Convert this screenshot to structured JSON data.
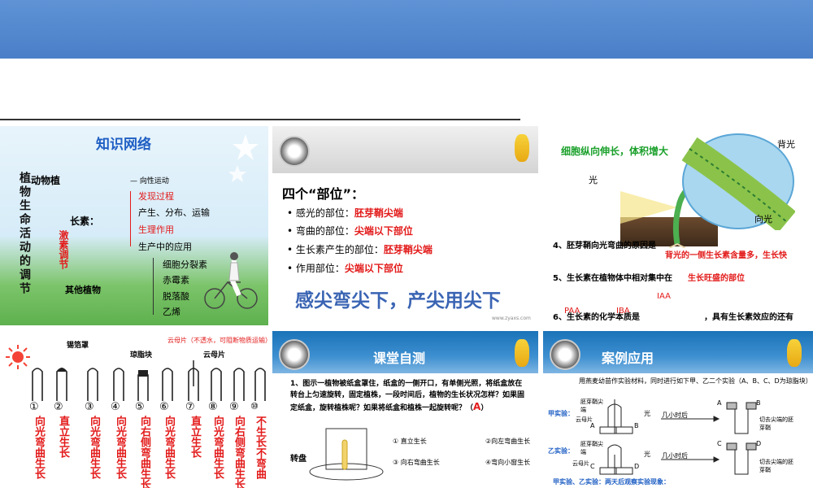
{
  "slide1": {
    "title": "知识网络",
    "vertical_title": "植物生命活动的调节",
    "top_branch": "动物植",
    "top_right": "— 向性运动",
    "growth": "长素：",
    "hormone": "激素调节",
    "items_red": [
      "发现过程",
      "生理作用"
    ],
    "items": [
      "产生、分布、运输",
      "生产中的应用"
    ],
    "other": "其他植物",
    "others": [
      "细胞分裂素",
      "赤霉素",
      "脱落酸",
      "乙烯"
    ]
  },
  "slide2": {
    "heading": "四个“部位”：",
    "rows": [
      {
        "label": "感光的部位：",
        "value": "胚芽鞘尖端"
      },
      {
        "label": "弯曲的部位：",
        "value": "尖端以下部位"
      },
      {
        "label": "生长素产生的部位：",
        "value": "胚芽鞘尖端"
      },
      {
        "label": "作用部位：",
        "value": "尖端以下部位"
      }
    ],
    "slogan": "感尖弯尖下，产尖用尖下",
    "footer": "www.zyaxs.com"
  },
  "slide3": {
    "caption_a": "细胞纵向伸长，",
    "caption_b": "体积增大",
    "label_back": "背光",
    "label_light": "光",
    "label_toward": "向光",
    "q4": "4、胚芽鞘向光弯曲的原因是",
    "a4": "背光的一侧生长素含量多，生长快",
    "q5": "5、生长素在植物体中相对集中在",
    "a5": "生长旺盛的部位",
    "a_iaa": "IAA",
    "q6": "6、生长素的化学本质是",
    "q6b": "，具有生长素效应的还有",
    "a_paa": "PAA",
    "a_iba": "IBA"
  },
  "slide4": {
    "labels_top": [
      "锡箔罩",
      "琼脂块",
      "云母片"
    ],
    "note": "云母片（不透水，可阻断物质运输）",
    "numbers": [
      "①",
      "②",
      "③",
      "④",
      "⑤",
      "⑥",
      "⑦",
      "⑧",
      "⑨",
      "⑩"
    ],
    "results": [
      "向光弯曲生长",
      "直立生长",
      "向光弯曲生长",
      "向光弯曲生长",
      "向右侧弯曲生长",
      "向光弯曲生长",
      "直立生长",
      "向光弯曲生长",
      "向右侧弯曲生长",
      "不生长不弯曲"
    ]
  },
  "slide5": {
    "title": "课堂自测",
    "question": "1、图示一植物被纸盒罩住，纸盒的一侧开口，有单侧光照，将纸盒放在转台上匀速旋转，固定植株，一段时间后，植物的生长状况怎样？如果固定纸盒，旋转植株呢？如果将纸盒和植株一起旋转呢？（",
    "answer": "A",
    "close": "）",
    "turntable": "转盘",
    "options": [
      "① 直立生长",
      "②向左弯曲生长",
      "③ 向右弯曲生长",
      "④弯向小窗生长"
    ]
  },
  "slide6": {
    "title": "案例应用",
    "intro": "用燕麦幼苗作实验材料，同时进行如下甲、乙二个实验（A、B、C、D为琼脂块）",
    "exp1": "甲实验：",
    "exp2": "乙实验：",
    "tip": "胚芽鞘尖端",
    "mica": "云母片",
    "light": "光",
    "hours": "几小时后",
    "cut": "切去尖端的胚芽鞘",
    "blocks": [
      "A",
      "B",
      "C",
      "D"
    ],
    "footer": "甲实验、乙实验：两天后观察实验现象："
  }
}
